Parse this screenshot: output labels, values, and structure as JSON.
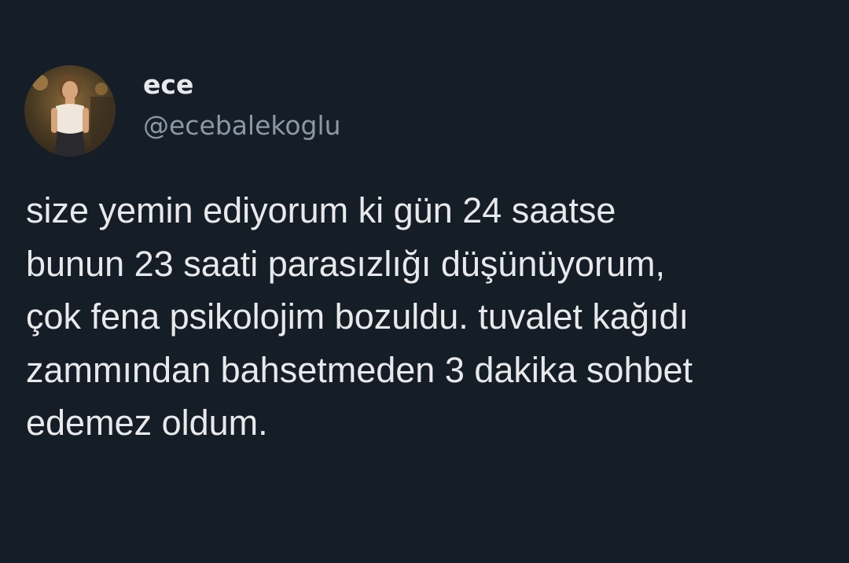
{
  "author": {
    "display_name": "ece",
    "handle": "@ecebalekoglu"
  },
  "tweet": {
    "text": "size yemin ediyorum ki gün 24 saatse\nbunun 23 saati parasızlığı düşünüyorum,\nçok fena psikolojim bozuldu. tuvalet kağıdı\nzammından bahsetmeden 3 dakika sohbet\nedemez oldum."
  },
  "colors": {
    "background": "#151d27",
    "text_primary": "#e7e9ea",
    "text_secondary": "#8b98a5"
  }
}
